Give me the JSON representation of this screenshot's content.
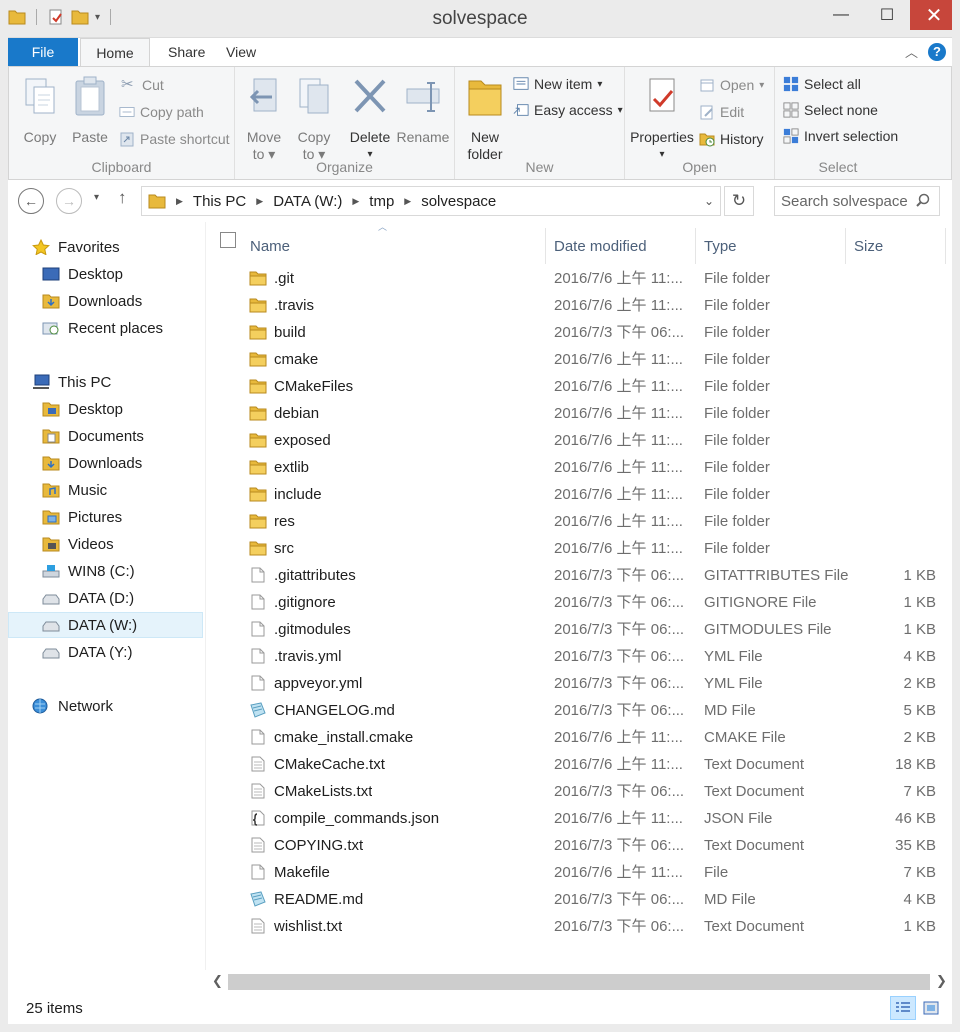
{
  "window": {
    "title": "solvespace",
    "controls": {
      "minimize": "—",
      "maximize": "☐",
      "close": "✕"
    }
  },
  "ribbon": {
    "tabs": {
      "file": "File",
      "home": "Home",
      "share": "Share",
      "view": "View"
    },
    "groups": {
      "clipboard": {
        "label": "Clipboard",
        "copy": "Copy",
        "paste": "Paste",
        "cut": "Cut",
        "copy_path": "Copy path",
        "paste_shortcut": "Paste shortcut"
      },
      "organize": {
        "label": "Organize",
        "move_to": "Move",
        "move_to_2": "to",
        "copy_to": "Copy",
        "copy_to_2": "to",
        "delete": "Delete",
        "rename": "Rename"
      },
      "new": {
        "label": "New",
        "new_folder": "New",
        "new_folder_2": "folder",
        "new_item": "New item",
        "easy_access": "Easy access"
      },
      "open": {
        "label": "Open",
        "properties": "Properties",
        "open": "Open",
        "edit": "Edit",
        "history": "History"
      },
      "select": {
        "label": "Select",
        "select_all": "Select all",
        "select_none": "Select none",
        "invert_selection": "Invert selection"
      }
    }
  },
  "address": {
    "breadcrumbs": [
      "This PC",
      "DATA (W:)",
      "tmp",
      "solvespace"
    ],
    "search_placeholder": "Search solvespace"
  },
  "nav": {
    "favorites": "Favorites",
    "fav_items": [
      "Desktop",
      "Downloads",
      "Recent places"
    ],
    "this_pc": "This PC",
    "pc_items": [
      "Desktop",
      "Documents",
      "Downloads",
      "Music",
      "Pictures",
      "Videos",
      "WIN8 (C:)",
      "DATA (D:)",
      "DATA (W:)",
      "DATA (Y:)"
    ],
    "network": "Network"
  },
  "columns": {
    "name": "Name",
    "date": "Date modified",
    "type": "Type",
    "size": "Size"
  },
  "files": [
    {
      "name": ".git",
      "date": "2016/7/6 上午 11:...",
      "type": "File folder",
      "size": "",
      "icon": "folder"
    },
    {
      "name": ".travis",
      "date": "2016/7/6 上午 11:...",
      "type": "File folder",
      "size": "",
      "icon": "folder"
    },
    {
      "name": "build",
      "date": "2016/7/3 下午 06:...",
      "type": "File folder",
      "size": "",
      "icon": "folder"
    },
    {
      "name": "cmake",
      "date": "2016/7/6 上午 11:...",
      "type": "File folder",
      "size": "",
      "icon": "folder"
    },
    {
      "name": "CMakeFiles",
      "date": "2016/7/6 上午 11:...",
      "type": "File folder",
      "size": "",
      "icon": "folder"
    },
    {
      "name": "debian",
      "date": "2016/7/6 上午 11:...",
      "type": "File folder",
      "size": "",
      "icon": "folder"
    },
    {
      "name": "exposed",
      "date": "2016/7/6 上午 11:...",
      "type": "File folder",
      "size": "",
      "icon": "folder"
    },
    {
      "name": "extlib",
      "date": "2016/7/6 上午 11:...",
      "type": "File folder",
      "size": "",
      "icon": "folder"
    },
    {
      "name": "include",
      "date": "2016/7/6 上午 11:...",
      "type": "File folder",
      "size": "",
      "icon": "folder"
    },
    {
      "name": "res",
      "date": "2016/7/6 上午 11:...",
      "type": "File folder",
      "size": "",
      "icon": "folder"
    },
    {
      "name": "src",
      "date": "2016/7/6 上午 11:...",
      "type": "File folder",
      "size": "",
      "icon": "folder"
    },
    {
      "name": ".gitattributes",
      "date": "2016/7/3 下午 06:...",
      "type": "GITATTRIBUTES File",
      "size": "1 KB",
      "icon": "file"
    },
    {
      "name": ".gitignore",
      "date": "2016/7/3 下午 06:...",
      "type": "GITIGNORE File",
      "size": "1 KB",
      "icon": "file"
    },
    {
      "name": ".gitmodules",
      "date": "2016/7/3 下午 06:...",
      "type": "GITMODULES File",
      "size": "1 KB",
      "icon": "file"
    },
    {
      "name": ".travis.yml",
      "date": "2016/7/3 下午 06:...",
      "type": "YML File",
      "size": "4 KB",
      "icon": "file"
    },
    {
      "name": "appveyor.yml",
      "date": "2016/7/3 下午 06:...",
      "type": "YML File",
      "size": "2 KB",
      "icon": "file"
    },
    {
      "name": "CHANGELOG.md",
      "date": "2016/7/3 下午 06:...",
      "type": "MD File",
      "size": "5 KB",
      "icon": "md"
    },
    {
      "name": "cmake_install.cmake",
      "date": "2016/7/6 上午 11:...",
      "type": "CMAKE File",
      "size": "2 KB",
      "icon": "file"
    },
    {
      "name": "CMakeCache.txt",
      "date": "2016/7/6 上午 11:...",
      "type": "Text Document",
      "size": "18 KB",
      "icon": "text"
    },
    {
      "name": "CMakeLists.txt",
      "date": "2016/7/3 下午 06:...",
      "type": "Text Document",
      "size": "7 KB",
      "icon": "text"
    },
    {
      "name": "compile_commands.json",
      "date": "2016/7/6 上午 11:...",
      "type": "JSON File",
      "size": "46 KB",
      "icon": "json"
    },
    {
      "name": "COPYING.txt",
      "date": "2016/7/3 下午 06:...",
      "type": "Text Document",
      "size": "35 KB",
      "icon": "text"
    },
    {
      "name": "Makefile",
      "date": "2016/7/6 上午 11:...",
      "type": "File",
      "size": "7 KB",
      "icon": "file"
    },
    {
      "name": "README.md",
      "date": "2016/7/3 下午 06:...",
      "type": "MD File",
      "size": "4 KB",
      "icon": "md"
    },
    {
      "name": "wishlist.txt",
      "date": "2016/7/3 下午 06:...",
      "type": "Text Document",
      "size": "1 KB",
      "icon": "text"
    }
  ],
  "status": {
    "item_count": "25 items"
  },
  "colors": {
    "accent": "#1979ca",
    "folder": "#e8b93c",
    "close": "#c7463b",
    "selection": "#cce8ff"
  }
}
